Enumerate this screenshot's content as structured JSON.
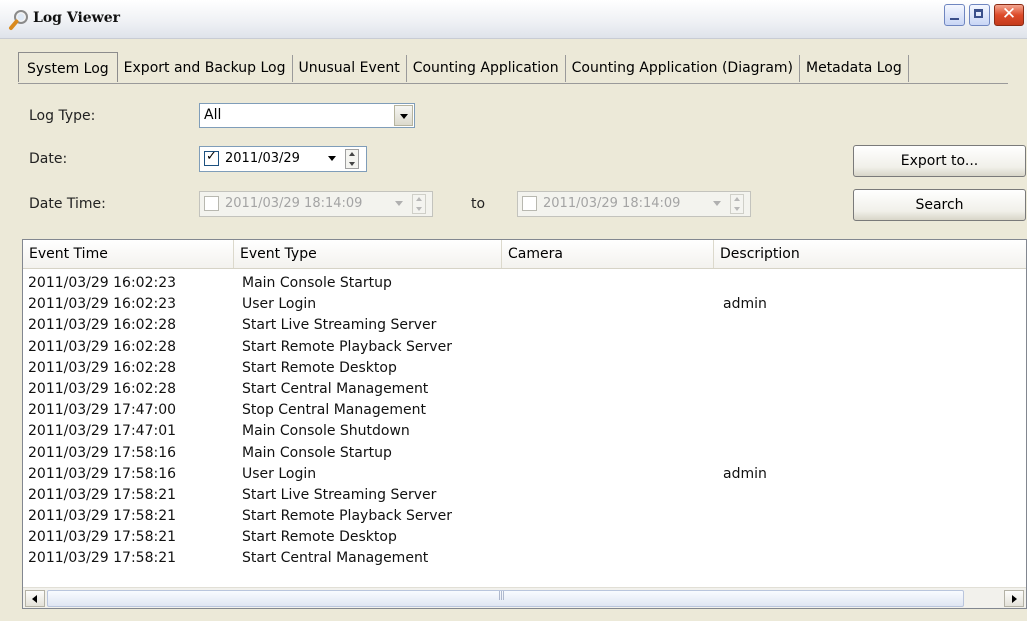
{
  "window": {
    "title": "Log Viewer"
  },
  "tabs": [
    {
      "label": "System Log"
    },
    {
      "label": "Export and Backup Log"
    },
    {
      "label": "Unusual Event"
    },
    {
      "label": "Counting Application"
    },
    {
      "label": "Counting Application (Diagram)"
    },
    {
      "label": "Metadata Log"
    }
  ],
  "filters": {
    "log_type_label": "Log Type:",
    "log_type_value": "All",
    "date_label": "Date:",
    "date_value": "2011/03/29",
    "date_checked": true,
    "datetime_label": "Date Time:",
    "datetime_from": "2011/03/29 18:14:09",
    "datetime_to_label": "to",
    "datetime_to": "2011/03/29 18:14:09"
  },
  "buttons": {
    "export_label": "Export to...",
    "search_label": "Search"
  },
  "table": {
    "columns": [
      "Event Time",
      "Event Type",
      "Camera",
      "Description"
    ],
    "rows": [
      [
        "2011/03/29 16:02:23",
        "Main Console Startup",
        "",
        ""
      ],
      [
        "2011/03/29 16:02:23",
        "User Login",
        "",
        "admin"
      ],
      [
        "2011/03/29 16:02:28",
        "Start Live Streaming Server",
        "",
        ""
      ],
      [
        "2011/03/29 16:02:28",
        "Start Remote Playback Server",
        "",
        ""
      ],
      [
        "2011/03/29 16:02:28",
        "Start Remote Desktop",
        "",
        ""
      ],
      [
        "2011/03/29 16:02:28",
        "Start Central Management",
        "",
        ""
      ],
      [
        "2011/03/29 17:47:00",
        "Stop Central Management",
        "",
        ""
      ],
      [
        "2011/03/29 17:47:01",
        "Main Console Shutdown",
        "",
        ""
      ],
      [
        "2011/03/29 17:58:16",
        "Main Console Startup",
        "",
        ""
      ],
      [
        "2011/03/29 17:58:16",
        "User Login",
        "",
        "admin"
      ],
      [
        "2011/03/29 17:58:21",
        "Start Live Streaming Server",
        "",
        ""
      ],
      [
        "2011/03/29 17:58:21",
        "Start Remote Playback Server",
        "",
        ""
      ],
      [
        "2011/03/29 17:58:21",
        "Start Remote Desktop",
        "",
        ""
      ],
      [
        "2011/03/29 17:58:21",
        "Start Central Management",
        "",
        ""
      ]
    ]
  },
  "icons": {
    "title_icon": "magnifier-icon",
    "minimize": "minimize-icon",
    "maximize": "maximize-icon",
    "close": "close-icon",
    "dropdown": "chevron-down-icon",
    "scroll_left": "arrow-left-icon",
    "scroll_right": "arrow-right-icon"
  },
  "colors": {
    "window_bg": "#ece9d8",
    "close_button": "#dd4b2a",
    "field_border": "#7f9db9"
  }
}
